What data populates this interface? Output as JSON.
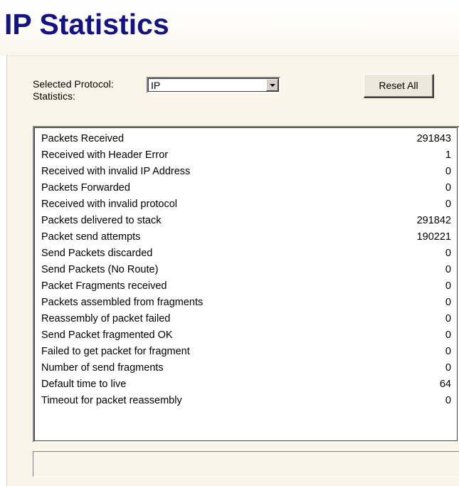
{
  "page": {
    "title": "IP Statistics"
  },
  "controls": {
    "protocol_label_line1": "Selected Protocol:",
    "protocol_label_line2": "Statistics:",
    "protocol_value": "IP",
    "reset_label": "Reset All"
  },
  "statistics": [
    {
      "name": "Packets Received",
      "value": "291843"
    },
    {
      "name": "Received with Header Error",
      "value": "1"
    },
    {
      "name": "Received with invalid IP Address",
      "value": "0"
    },
    {
      "name": "Packets Forwarded",
      "value": "0"
    },
    {
      "name": "Received with invalid protocol",
      "value": "0"
    },
    {
      "name": "Packets delivered to stack",
      "value": "291842"
    },
    {
      "name": "Packet send attempts",
      "value": "190221"
    },
    {
      "name": "Send Packets discarded",
      "value": "0"
    },
    {
      "name": "Send Packets (No Route)",
      "value": "0"
    },
    {
      "name": "Packet Fragments received",
      "value": "0"
    },
    {
      "name": "Packets assembled from fragments",
      "value": "0"
    },
    {
      "name": "Reassembly of packet failed",
      "value": "0"
    },
    {
      "name": "Send Packet fragmented OK",
      "value": "0"
    },
    {
      "name": "Failed to get packet for fragment",
      "value": "0"
    },
    {
      "name": "Number of send fragments",
      "value": "0"
    },
    {
      "name": "Default time to live",
      "value": "64"
    },
    {
      "name": "Timeout for packet reassembly",
      "value": "0"
    }
  ],
  "status_bar": {
    "text": ""
  },
  "colors": {
    "title": "#131384",
    "panel_background": "#faf5e8",
    "button_face": "#ece8dc"
  },
  "icons": {
    "combo_arrow": "chevron-down-icon"
  }
}
